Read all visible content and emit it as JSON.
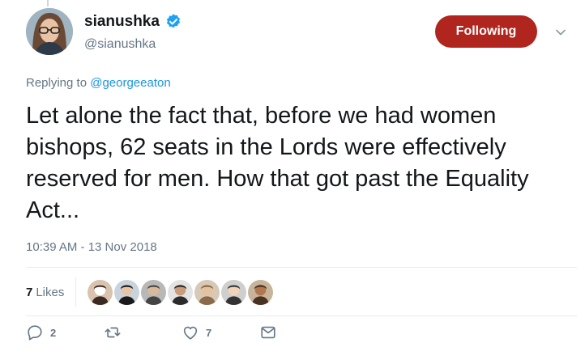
{
  "tweet": {
    "display_name": "sianushka",
    "handle": "@sianushka",
    "follow_button": "Following",
    "replying_prefix": "Replying to",
    "replying_to": "@georgeeaton",
    "text": "Let alone the fact that, before we had women bishops, 62 seats in the Lords were effectively reserved for men. How that got past the Equality Act...",
    "timestamp": "10:39 AM - 13 Nov 2018",
    "likes_count": "7",
    "likes_label": "Likes",
    "likers_count": 7,
    "actions": {
      "reply_count": "2",
      "retweet_count": "",
      "like_count": "7"
    }
  },
  "colors": {
    "following_button": "#b0261e",
    "link": "#1b95e0",
    "muted": "#657786",
    "verified": "#1da1f2"
  },
  "icons": [
    "verified-badge-icon",
    "chevron-down-icon",
    "reply-icon",
    "retweet-icon",
    "like-icon",
    "direct-message-icon"
  ]
}
